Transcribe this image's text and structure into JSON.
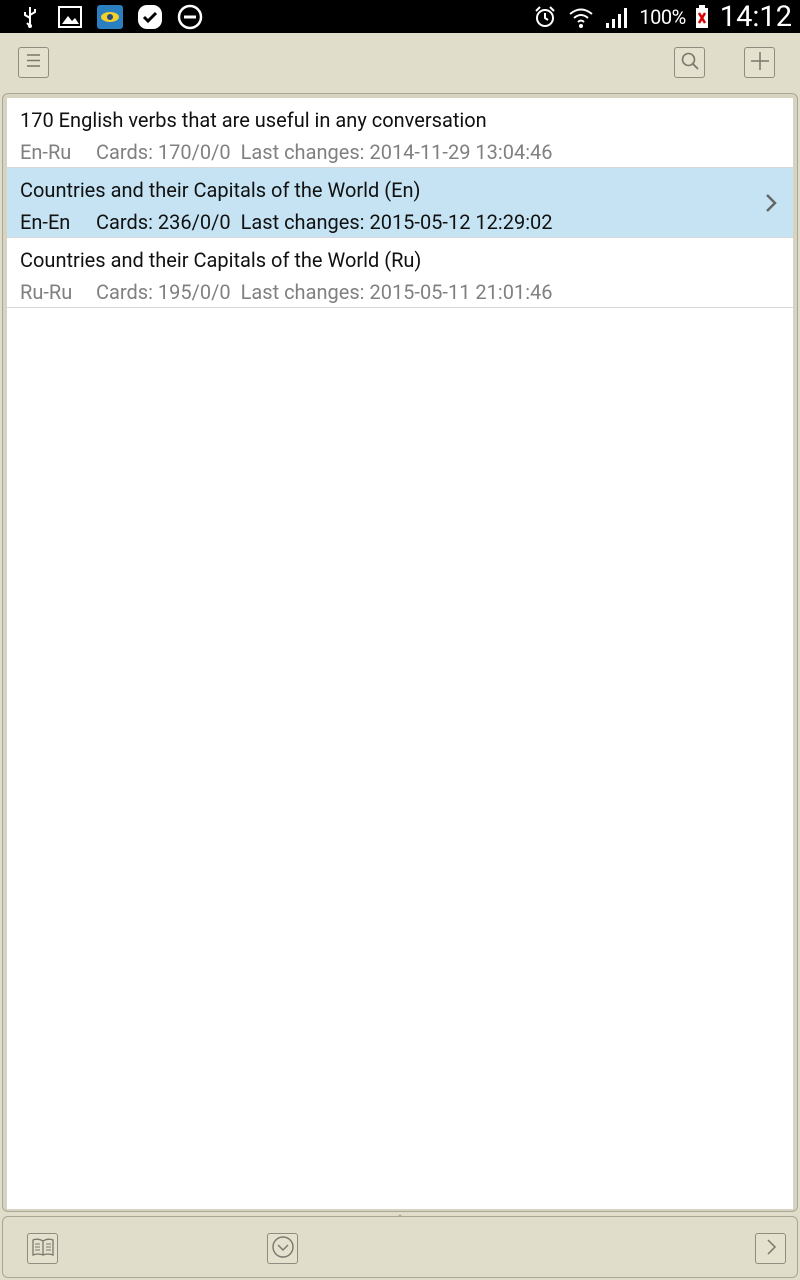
{
  "status_bar": {
    "battery": "100%",
    "time": "14:12"
  },
  "toolbar": {
    "menu_icon": "menu-lines-icon",
    "search_icon": "search-icon",
    "add_icon": "plus-icon"
  },
  "dictionaries": [
    {
      "title": "170 English verbs that are useful in any conversation",
      "lang": "En-Ru",
      "cards": "Cards: 170/0/0",
      "last_changes": "Last changes: 2014-11-29 13:04:46",
      "selected": false
    },
    {
      "title": "Countries and their Capitals of the World (En)",
      "lang": "En-En",
      "cards": "Cards: 236/0/0",
      "last_changes": "Last changes: 2015-05-12 12:29:02",
      "selected": true
    },
    {
      "title": "Countries and their Capitals of the World (Ru)",
      "lang": "Ru-Ru",
      "cards": "Cards: 195/0/0",
      "last_changes": "Last changes: 2015-05-11 21:01:46",
      "selected": false
    }
  ],
  "bottom_bar": {
    "book_icon": "open-book-icon",
    "center_icon": "circle-chevron-icon",
    "next_icon": "chevron-right-icon"
  },
  "colors": {
    "bar_bg": "#e0ddca",
    "selected_row": "#c5e3f3",
    "meta_text": "#808080"
  }
}
